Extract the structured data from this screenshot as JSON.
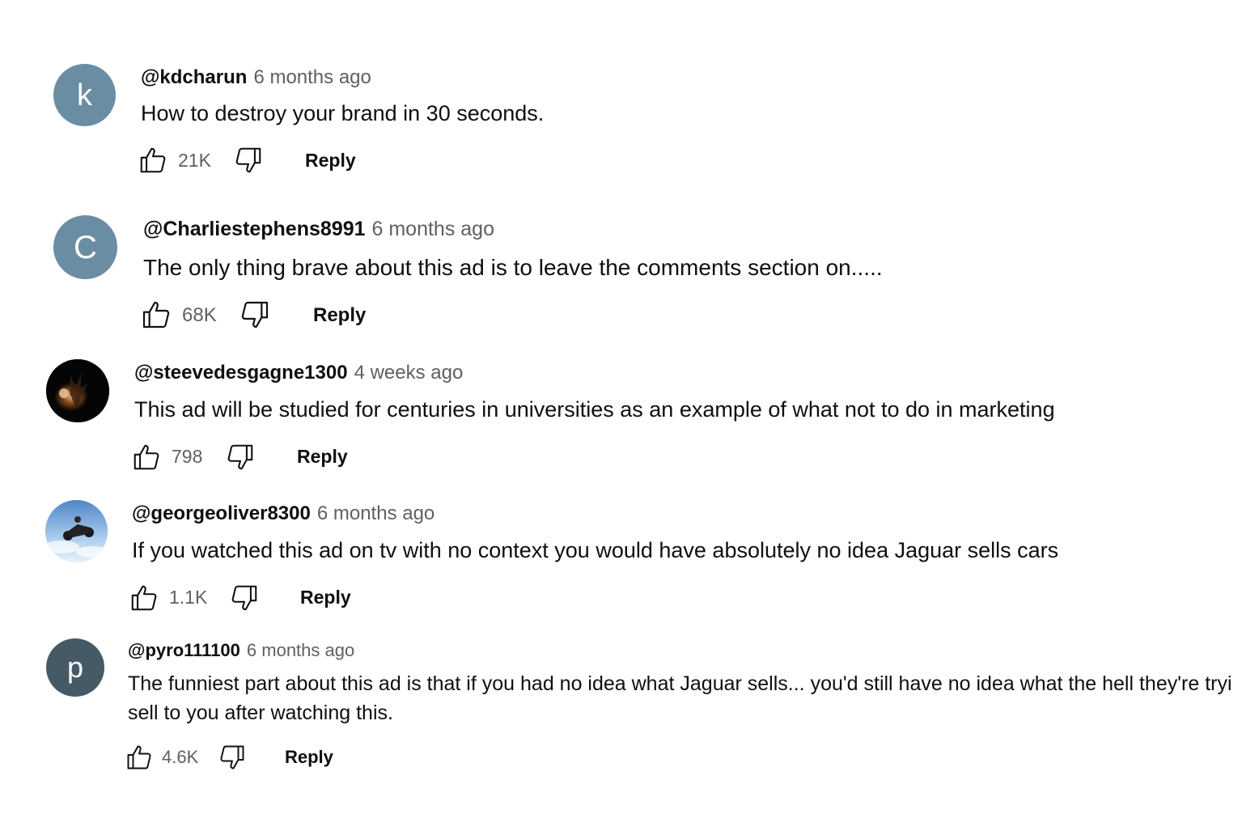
{
  "comments": [
    {
      "handle": "@kdcharun",
      "time": "6 months ago",
      "text": "How to destroy your brand in 30 seconds.",
      "likes": "21K",
      "reply_label": "Reply",
      "avatar_initial": "k",
      "avatar_color": "#6b8da3"
    },
    {
      "handle": "@Charliestephens8991",
      "time": "6 months ago",
      "text": "The only thing brave about this ad is to leave the comments section on.....",
      "likes": "68K",
      "reply_label": "Reply",
      "avatar_initial": "C",
      "avatar_color": "#6b8da3"
    },
    {
      "handle": "@steevedesgagne1300",
      "time": "4 weeks ago",
      "text": "This ad will be studied for centuries in universities as an example of what not to do in marketing",
      "likes": "798",
      "reply_label": "Reply",
      "avatar_kind": "photo-dark"
    },
    {
      "handle": "@georgeoliver8300",
      "time": "6 months ago",
      "text": "If you watched this ad on tv with no context you would have absolutely no idea Jaguar sells cars",
      "likes": "1.1K",
      "reply_label": "Reply",
      "avatar_kind": "photo-sky"
    },
    {
      "handle": "@pyro111100",
      "time": "6 months ago",
      "text_line1": "The funniest part about this ad is that if you had no idea what Jaguar sells... you'd still have no idea what the hell they're tryi",
      "text_line2": "sell to you after watching this.",
      "likes": "4.6K",
      "reply_label": "Reply",
      "avatar_initial": "p",
      "avatar_color": "#455a64"
    }
  ],
  "icons": {
    "like": "thumbs-up-icon",
    "dislike": "thumbs-down-icon"
  }
}
